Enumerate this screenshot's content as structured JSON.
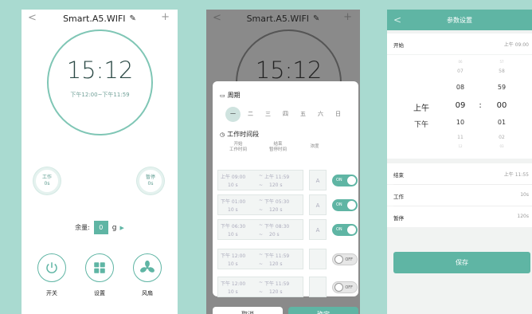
{
  "phone1": {
    "device_name": "Smart.A5.WIFI",
    "back_glyph": "<",
    "plus_glyph": "+",
    "edit_glyph": "✎",
    "clock_time": "15:12",
    "time_range": "下午12:00~下午11:59",
    "work_label": "工作",
    "work_value": "0s",
    "pause_label": "暂停",
    "pause_value": "0s",
    "remain_label": "余量:",
    "remain_value": "0",
    "remain_unit": "g",
    "arrow_glyph": "▶",
    "power_label": "开关",
    "settings_label": "设置",
    "fan_label": "风扇"
  },
  "phone2": {
    "device_name": "Smart.A5.WIFI",
    "back_glyph": "<",
    "plus_glyph": "+",
    "edit_glyph": "✎",
    "clock_time": "15:12",
    "cycle_title": "周期",
    "cycle_glyph": "▭",
    "days": [
      "一",
      "二",
      "三",
      "四",
      "五",
      "六",
      "日"
    ],
    "days_selected": [
      true,
      false,
      false,
      false,
      false,
      false,
      false
    ],
    "period_title": "工作时间段",
    "period_glyph": "◷",
    "col_start": "开始",
    "col_work_time": "工作时间",
    "col_end": "结束",
    "col_pause_time": "暂停时间",
    "col_concentration": "浓度",
    "tilde": "~",
    "rows": [
      {
        "start": "上午 09:00",
        "end": "上午 11:59",
        "work": "10 s",
        "pause": "120 s",
        "mode": "A",
        "toggle": "ON",
        "on": true
      },
      {
        "start": "下午 01:00",
        "end": "下午 05:30",
        "work": "10 s",
        "pause": "120 s",
        "mode": "A",
        "toggle": "ON",
        "on": true
      },
      {
        "start": "下午 06:30",
        "end": "下午 08:30",
        "work": "10 s",
        "pause": "20 s",
        "mode": "A",
        "toggle": "ON",
        "on": true
      },
      {
        "start": "下午 12:00",
        "end": "下午 11:59",
        "work": "10 s",
        "pause": "120 s",
        "mode": "",
        "toggle": "OFF",
        "on": false
      },
      {
        "start": "下午 12:00",
        "end": "下午 11:59",
        "work": "10 s",
        "pause": "120 s",
        "mode": "",
        "toggle": "OFF",
        "on": false
      }
    ],
    "cancel_label": "取消",
    "ok_label": "确定"
  },
  "phone3": {
    "title": "参数设置",
    "back_glyph": "<",
    "start_label": "开始",
    "start_value": "上午 09:00",
    "ampm_options": [
      "上午",
      "下午"
    ],
    "hour_options": [
      "06",
      "07",
      "08",
      "09",
      "10",
      "11",
      "12"
    ],
    "minute_options": [
      "57",
      "58",
      "59",
      "00",
      "01",
      "02",
      "03"
    ],
    "colon": ":",
    "end_label": "结束",
    "end_value": "上午 11:55",
    "work_label": "工作",
    "work_value": "10s",
    "pause_label": "暂停",
    "pause_value": "120s",
    "save_label": "保存"
  },
  "colors": {
    "accent": "#5fb5a4",
    "background": "#a9dad0"
  }
}
